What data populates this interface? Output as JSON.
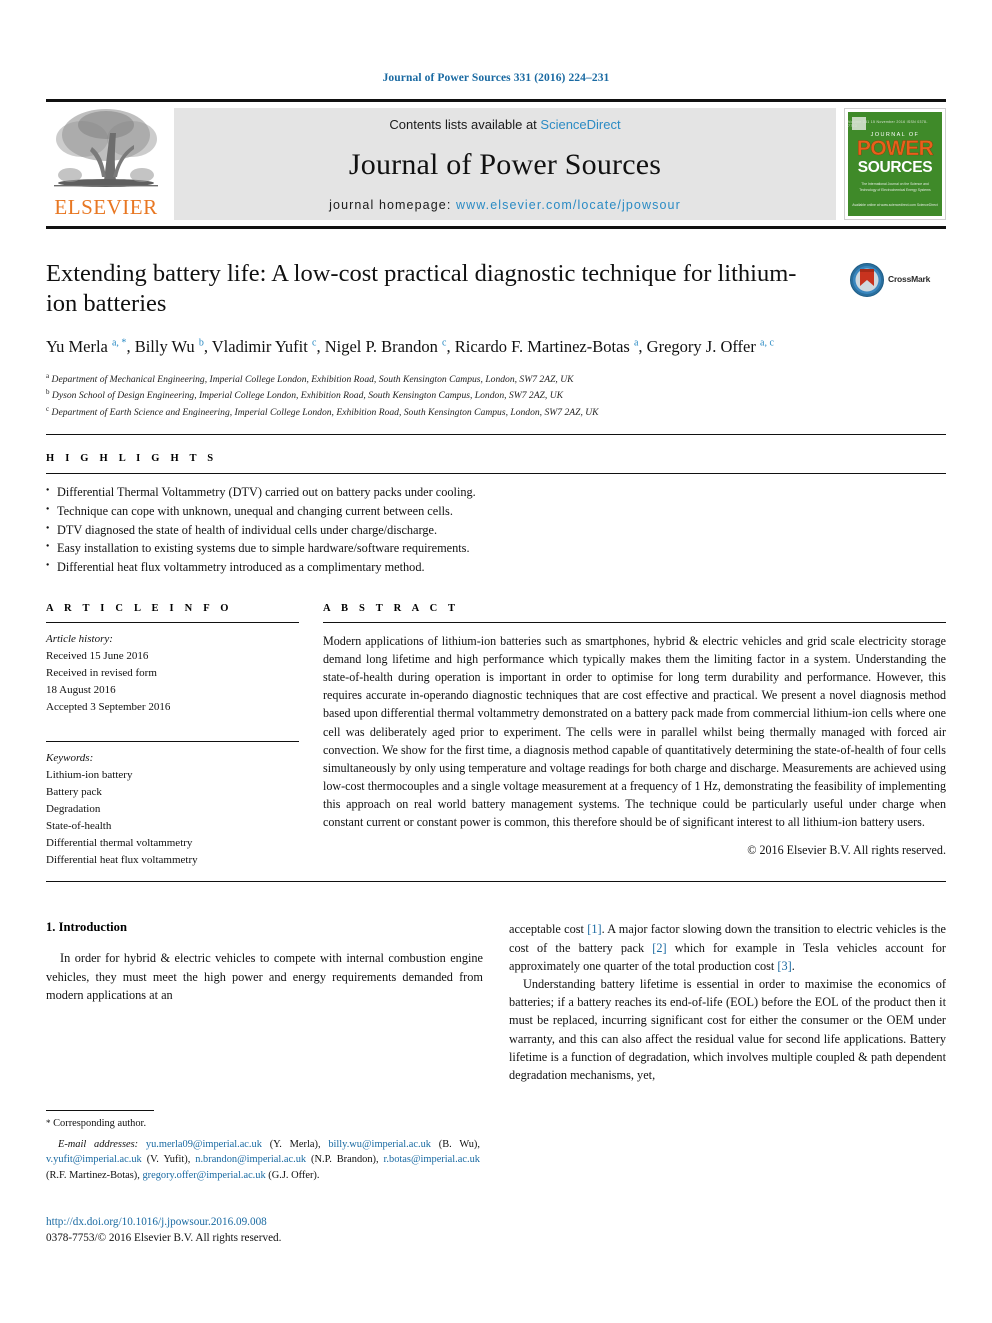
{
  "running_head": "Journal of Power Sources 331 (2016) 224–231",
  "masthead": {
    "contents_prefix": "Contents lists available at ",
    "sciencedirect": "ScienceDirect",
    "journal_name": "Journal of Power Sources",
    "homepage_prefix": "journal homepage: ",
    "homepage_url": "www.elsevier.com/locate/jpowsour",
    "publisher_wordmark": "ELSEVIER",
    "cover": {
      "journal_of": "JOURNAL OF",
      "power": "POWER",
      "sources": "SOURCES",
      "issue_line": "Volume 331  15 November 2016  ISSN 0378-7753",
      "subtitle": "The International Journal on the Science and Technology of Electrochemical Energy Systems",
      "footer": "Available online at www.sciencedirect.com\nScienceDirect"
    },
    "colors": {
      "link": "#2b8bc4",
      "elsevier_orange": "#E87722",
      "cover_green": "#3f8a29",
      "band_gray": "#e4e4e4"
    }
  },
  "article": {
    "title": "Extending battery life: A low-cost practical diagnostic technique for lithium-ion batteries",
    "crossmark_label": "CrossMark",
    "authors_html": "Yu Merla <sup>a, *</sup>, Billy Wu <sup>b</sup>, Vladimir Yufit <sup>c</sup>, Nigel P. Brandon <sup>c</sup>, Ricardo F. Martinez-Botas <sup>a</sup>, Gregory J. Offer <sup>a, c</sup>",
    "affiliations": [
      {
        "marker": "a",
        "text": "Department of Mechanical Engineering, Imperial College London, Exhibition Road, South Kensington Campus, London, SW7 2AZ, UK"
      },
      {
        "marker": "b",
        "text": "Dyson School of Design Engineering, Imperial College London, Exhibition Road, South Kensington Campus, London, SW7 2AZ, UK"
      },
      {
        "marker": "c",
        "text": "Department of Earth Science and Engineering, Imperial College London, Exhibition Road, South Kensington Campus, London, SW7 2AZ, UK"
      }
    ]
  },
  "highlights": {
    "label": "H I G H L I G H T S",
    "items": [
      "Differential Thermal Voltammetry (DTV) carried out on battery packs under cooling.",
      "Technique can cope with unknown, unequal and changing current between cells.",
      "DTV diagnosed the state of health of individual cells under charge/discharge.",
      "Easy installation to existing systems due to simple hardware/software requirements.",
      "Differential heat flux voltammetry introduced as a complimentary method."
    ]
  },
  "article_info": {
    "label": "A R T I C L E   I N F O",
    "history_label": "Article history:",
    "history_lines": [
      "Received 15 June 2016",
      "Received in revised form",
      "18 August 2016",
      "Accepted 3 September 2016"
    ],
    "keywords_label": "Keywords:",
    "keywords": [
      "Lithium-ion battery",
      "Battery pack",
      "Degradation",
      "State-of-health",
      "Differential thermal voltammetry",
      "Differential heat flux voltammetry"
    ]
  },
  "abstract": {
    "label": "A B S T R A C T",
    "text": "Modern applications of lithium-ion batteries such as smartphones, hybrid & electric vehicles and grid scale electricity storage demand long lifetime and high performance which typically makes them the limiting factor in a system. Understanding the state-of-health during operation is important in order to optimise for long term durability and performance. However, this requires accurate in-operando diagnostic techniques that are cost effective and practical. We present a novel diagnosis method based upon differential thermal voltammetry demonstrated on a battery pack made from commercial lithium-ion cells where one cell was deliberately aged prior to experiment. The cells were in parallel whilst being thermally managed with forced air convection. We show for the first time, a diagnosis method capable of quantitatively determining the state-of-health of four cells simultaneously by only using temperature and voltage readings for both charge and discharge. Measurements are achieved using low-cost thermocouples and a single voltage measurement at a frequency of 1 Hz, demonstrating the feasibility of implementing this approach on real world battery management systems. The technique could be particularly useful under charge when constant current or constant power is common, this therefore should be of significant interest to all lithium-ion battery users.",
    "copyright": "© 2016 Elsevier B.V. All rights reserved."
  },
  "body": {
    "section_number_title": "1.  Introduction",
    "left_paragraph": "In order for hybrid & electric vehicles to compete with internal combustion engine vehicles, they must meet the high power and energy requirements demanded from modern applications at an",
    "right_paragraph_1_pre": "acceptable cost ",
    "right_ref_1": "[1]",
    "right_paragraph_1_mid": ". A major factor slowing down the transition to electric vehicles is the cost of the battery pack ",
    "right_ref_2": "[2]",
    "right_paragraph_1_mid2": " which for example in Tesla vehicles account for approximately one quarter of the total production cost ",
    "right_ref_3": "[3]",
    "right_paragraph_1_end": ".",
    "right_paragraph_2": "Understanding battery lifetime is essential in order to maximise the economics of batteries; if a battery reaches its end-of-life (EOL) before the EOL of the product then it must be replaced, incurring significant cost for either the consumer or the OEM under warranty, and this can also affect the residual value for second life applications. Battery lifetime is a function of degradation, which involves multiple coupled & path dependent degradation mechanisms, yet,"
  },
  "footnote": {
    "corresponding": "Corresponding author.",
    "email_label": "E-mail addresses:",
    "emails": [
      {
        "address": "yu.merla09@imperial.ac.uk",
        "name": "(Y. Merla)"
      },
      {
        "address": "billy.wu@imperial.ac.uk",
        "name": "(B. Wu)"
      },
      {
        "address": "v.yufit@imperial.ac.uk",
        "name": "(V. Yufit)"
      },
      {
        "address": "n.brandon@imperial.ac.uk",
        "name": "(N.P. Brandon)"
      },
      {
        "address": "r.botas@imperial.ac.uk",
        "name": "(R.F. Martinez-Botas)"
      },
      {
        "address": "gregory.offer@imperial.ac.uk",
        "name": "(G.J. Offer)"
      }
    ],
    "doi": "http://dx.doi.org/10.1016/j.jpowsour.2016.09.008",
    "issn_line": "0378-7753/© 2016 Elsevier B.V. All rights reserved."
  }
}
